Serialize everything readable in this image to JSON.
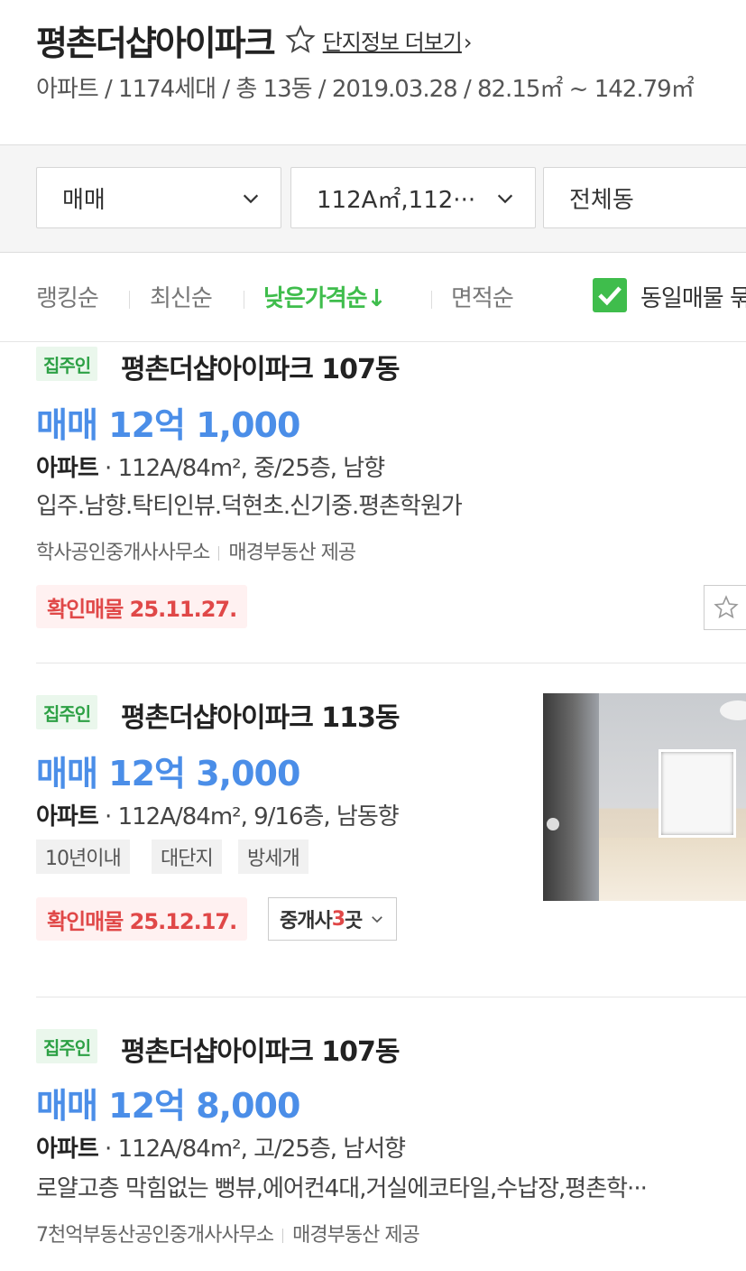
{
  "header": {
    "complex_name": "평촌더샵아이파크",
    "more_link": "단지정보 더보기",
    "meta": "아파트 / 1174세대 / 총 13동 / 2019.03.28 / 82.15㎡ ~ 142.79㎡"
  },
  "filters": {
    "trade_type": "매매",
    "area": "112A㎡,112···",
    "building": "전체동"
  },
  "sort": {
    "items": [
      "랭킹순",
      "최신순",
      "낮은가격순↓",
      "면적순"
    ],
    "active_index": 2,
    "same_listing_label": "동일매물 묶기",
    "same_listing_checked": true
  },
  "listings": [
    {
      "badge": "집주인",
      "title": "평촌더샵아이파크 107동",
      "price": "매매 12억 1,000",
      "kind": "아파트",
      "spec": "112A/84m², 중/25층, 남향",
      "desc": "입주.남향.탁티인뷰.덕현초.신기중.평촌학원가",
      "agency": "학사공인중개사사무소",
      "provider": "매경부동산 제공",
      "verified": "확인매물 25.11.27."
    },
    {
      "badge": "집주인",
      "title": "평촌더샵아이파크 113동",
      "price": "매매 12억 3,000",
      "kind": "아파트",
      "spec": "112A/84m², 9/16층, 남동향",
      "tags": [
        "10년이내",
        "대단지",
        "방세개"
      ],
      "verified": "확인매물 25.12.17.",
      "broker_prefix": "중개사 ",
      "broker_count": "3",
      "broker_suffix": "곳"
    },
    {
      "badge": "집주인",
      "title": "평촌더샵아이파크 107동",
      "price": "매매 12억 8,000",
      "kind": "아파트",
      "spec": "112A/84m², 고/25층, 남서향",
      "desc": "로얄고층 막힘없는 뻥뷰,에어컨4대,거실에코타일,수납장,평촌학···",
      "agency": "7천억부동산공인중개사사무소",
      "provider": "매경부동산 제공"
    }
  ],
  "colors": {
    "green": "#3fbd4c",
    "price_blue": "#4b8ee8",
    "verified_red": "#e04848"
  }
}
